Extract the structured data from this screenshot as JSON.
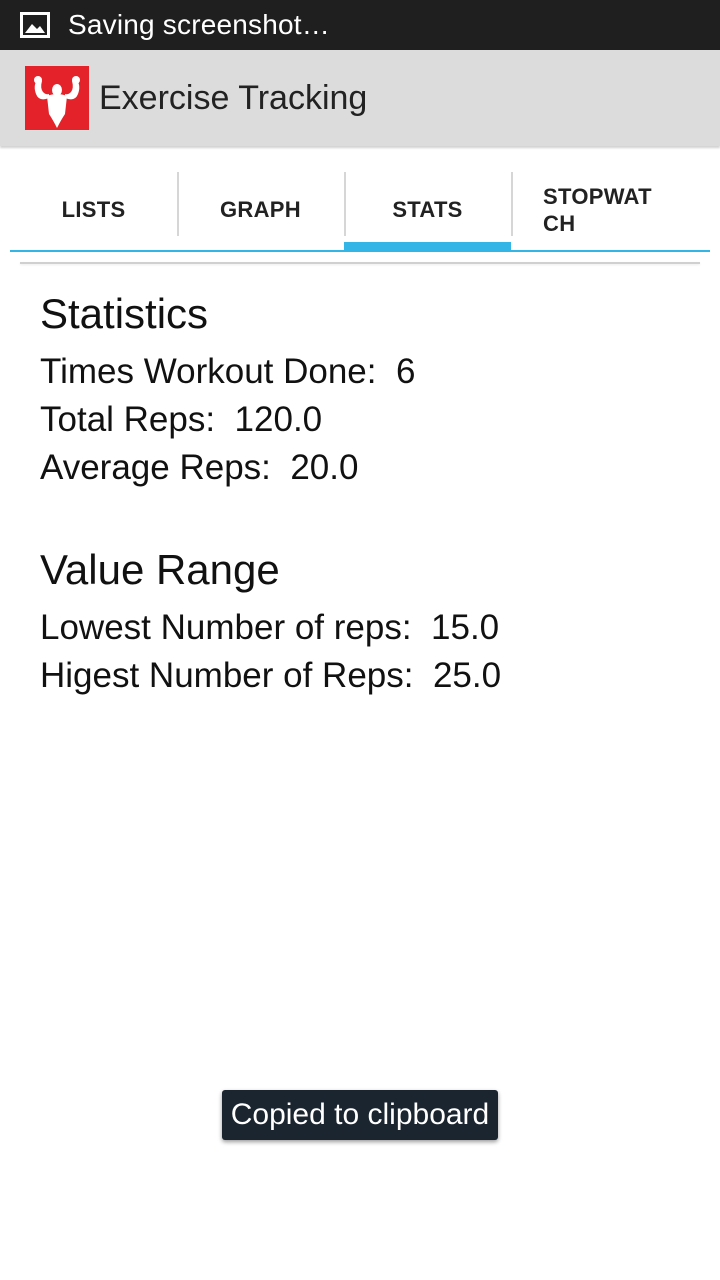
{
  "status_bar": {
    "icon": "image-icon",
    "text": "Saving screenshot…"
  },
  "action_bar": {
    "icon": "bodybuilder-icon",
    "title": "Exercise Tracking"
  },
  "tabs": [
    {
      "label": "LISTS",
      "active": false
    },
    {
      "label": "GRAPH",
      "active": false
    },
    {
      "label": "STATS",
      "active": true
    },
    {
      "label": "STOPWATCH",
      "active": false
    }
  ],
  "statistics": {
    "title": "Statistics",
    "rows": [
      {
        "label": "Times Workout Done:",
        "value": "6"
      },
      {
        "label": "Total Reps:",
        "value": "120.0"
      },
      {
        "label": "Average Reps:",
        "value": "20.0"
      }
    ]
  },
  "value_range": {
    "title": "Value Range",
    "rows": [
      {
        "label": "Lowest Number of reps:",
        "value": "15.0"
      },
      {
        "label": "Higest Number of Reps:",
        "value": "25.0"
      }
    ]
  },
  "toast": {
    "text": "Copied to clipboard"
  },
  "colors": {
    "accent": "#33b5e5",
    "app_icon_bg": "#e3222a",
    "toast_bg": "#1b2530",
    "status_bar_bg": "#1f1f1f",
    "action_bar_bg": "#dcdcdc"
  }
}
